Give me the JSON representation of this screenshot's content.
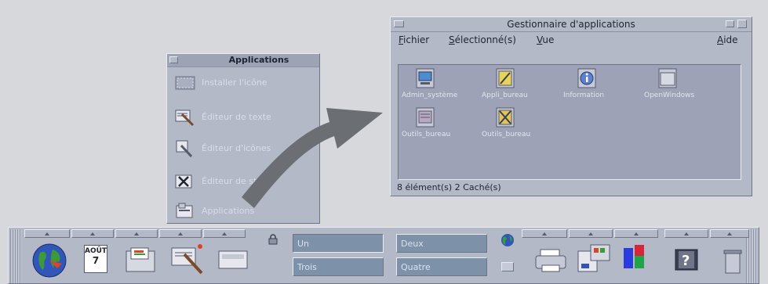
{
  "subpanel": {
    "title": "Applications",
    "items": [
      {
        "label": "Installer l'icône",
        "icon": "drop-zone-icon"
      },
      {
        "label": "Éditeur de texte",
        "icon": "text-editor-icon"
      },
      {
        "label": "Éditeur d'icônes",
        "icon": "icon-editor-icon"
      },
      {
        "label": "Éditeur de style",
        "icon": "style-editor-icon"
      },
      {
        "label": "Applications",
        "icon": "app-manager-icon"
      }
    ]
  },
  "app_manager": {
    "title": "Gestionnaire d'applications",
    "menus": {
      "fichier": "ichier",
      "fichier_key": "F",
      "selectionne": "électionné(s)",
      "selectionne_key": "S",
      "vue": "ue",
      "vue_key": "V",
      "aide": "ide",
      "aide_key": "A"
    },
    "items": [
      {
        "label": "Admin_système",
        "icon": "monitor-icon"
      },
      {
        "label": "Appli_bureau",
        "icon": "desktop-apps-icon"
      },
      {
        "label": "Information",
        "icon": "info-icon"
      },
      {
        "label": "OpenWindows",
        "icon": "folder-icon"
      },
      {
        "label": "Outils_bureau",
        "icon": "desktop-tools-icon"
      },
      {
        "label": "Outils_bureau",
        "icon": "desktop-tools-2-icon"
      }
    ],
    "status": "8 élément(s) 2 Caché(s)"
  },
  "front_panel": {
    "workspaces": [
      "Un",
      "Deux",
      "Trois",
      "Quatre"
    ],
    "date_label": "AOÛT",
    "date_day": "7"
  },
  "colors": {
    "panel": "#b4b9c8",
    "workspace_button": "#7d91a9",
    "arrow": "#6b6e73"
  }
}
